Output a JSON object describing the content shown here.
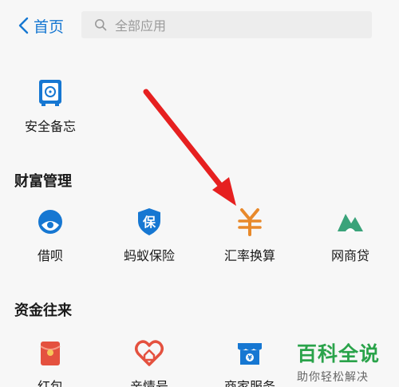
{
  "header": {
    "back_label": "首页",
    "search_placeholder": "全部应用"
  },
  "apps_top": [
    {
      "label": "安全备忘",
      "icon": "safe-box-icon"
    }
  ],
  "sections": [
    {
      "title": "财富管理",
      "apps": [
        {
          "label": "借呗",
          "icon": "jiebei-icon"
        },
        {
          "label": "蚂蚁保险",
          "icon": "insurance-shield-icon"
        },
        {
          "label": "汇率换算",
          "icon": "yuan-exchange-icon"
        },
        {
          "label": "网商贷",
          "icon": "mybank-loan-icon"
        }
      ]
    },
    {
      "title": "资金往来",
      "apps": [
        {
          "label": "红包",
          "icon": "red-envelope-icon"
        },
        {
          "label": "亲情号",
          "icon": "family-heart-icon"
        },
        {
          "label": "商家服务",
          "icon": "merchant-shop-icon"
        }
      ]
    }
  ],
  "colors": {
    "accent": "#1677d2",
    "arrow": "#e62020",
    "yuan": "#e8892b",
    "loan": "#3aa37a",
    "red": "#e4513f",
    "watermark": "#2aa34a"
  },
  "watermark": {
    "main": "百科全说",
    "sub": "助你轻松解决"
  }
}
